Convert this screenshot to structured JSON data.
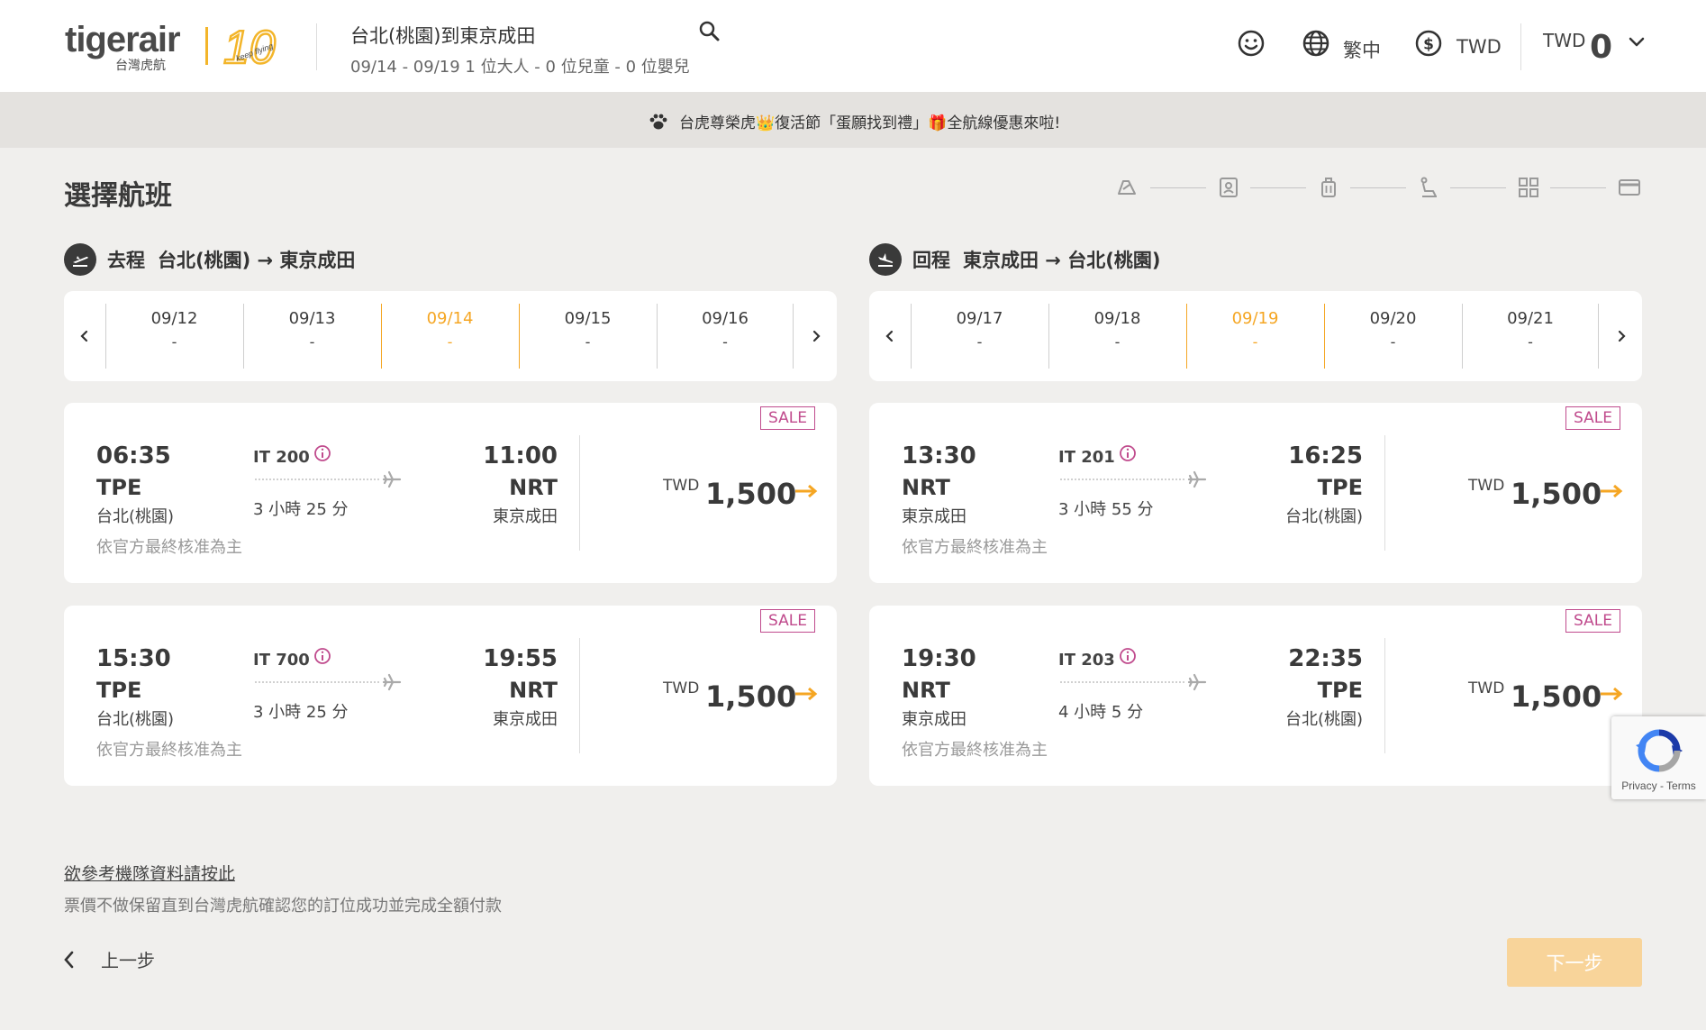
{
  "header": {
    "logo_text": "tigerair",
    "logo_sub": "台灣虎航",
    "logo_anniv": "10",
    "logo_tag": "keep flying",
    "route_title": "台北(桃園)到東京成田",
    "route_sub": "09/14 - 09/19 1 位大人 - 0 位兒童 - 0 位嬰兒",
    "language": "繁中",
    "currency": "TWD",
    "cart_currency": "TWD",
    "cart_total": "0"
  },
  "banner": {
    "text": "台虎尊榮虎👑復活節「蛋願找到禮」🎁全航線優惠來啦!"
  },
  "page": {
    "title": "選擇航班"
  },
  "steps": [
    "flight-icon",
    "passenger-icon",
    "baggage-icon",
    "seat-icon",
    "addons-icon",
    "payment-icon"
  ],
  "outbound": {
    "label": "去程",
    "route": "台北(桃園) → 東京成田",
    "dates": [
      {
        "date": "09/12",
        "price": "-"
      },
      {
        "date": "09/13",
        "price": "-"
      },
      {
        "date": "09/14",
        "price": "-"
      },
      {
        "date": "09/15",
        "price": "-"
      },
      {
        "date": "09/16",
        "price": "-"
      }
    ],
    "flights": [
      {
        "sale": "SALE",
        "dep_time": "06:35",
        "dep_code": "TPE",
        "dep_name": "台北(桃園)",
        "flight_no": "IT 200",
        "duration": "3 小時 25 分",
        "arr_time": "11:00",
        "arr_code": "NRT",
        "arr_name": "東京成田",
        "note": "依官方最終核准為主",
        "currency": "TWD",
        "price": "1,500"
      },
      {
        "sale": "SALE",
        "dep_time": "15:30",
        "dep_code": "TPE",
        "dep_name": "台北(桃園)",
        "flight_no": "IT 700",
        "duration": "3 小時 25 分",
        "arr_time": "19:55",
        "arr_code": "NRT",
        "arr_name": "東京成田",
        "note": "依官方最終核准為主",
        "currency": "TWD",
        "price": "1,500"
      }
    ]
  },
  "inbound": {
    "label": "回程",
    "route": "東京成田 → 台北(桃園)",
    "dates": [
      {
        "date": "09/17",
        "price": "-"
      },
      {
        "date": "09/18",
        "price": "-"
      },
      {
        "date": "09/19",
        "price": "-"
      },
      {
        "date": "09/20",
        "price": "-"
      },
      {
        "date": "09/21",
        "price": "-"
      }
    ],
    "flights": [
      {
        "sale": "SALE",
        "dep_time": "13:30",
        "dep_code": "NRT",
        "dep_name": "東京成田",
        "flight_no": "IT 201",
        "duration": "3 小時 55 分",
        "arr_time": "16:25",
        "arr_code": "TPE",
        "arr_name": "台北(桃園)",
        "note": "依官方最終核准為主",
        "currency": "TWD",
        "price": "1,500"
      },
      {
        "sale": "SALE",
        "dep_time": "19:30",
        "dep_code": "NRT",
        "dep_name": "東京成田",
        "flight_no": "IT 203",
        "duration": "4 小時 5 分",
        "arr_time": "22:35",
        "arr_code": "TPE",
        "arr_name": "台北(桃園)",
        "note": "依官方最終核准為主",
        "currency": "TWD",
        "price": "1,500"
      }
    ]
  },
  "footer": {
    "fleet_link": "欲參考機隊資料請按此",
    "disclaimer": "票價不做保留直到台灣虎航確認您的訂位成功並完成全額付款",
    "back_label": "上一步",
    "next_label": "下一步"
  },
  "recaptcha": {
    "text": "Privacy - Terms"
  },
  "colors": {
    "accent": "#f5a623",
    "sale": "#c04b8d",
    "next_disabled": "#f8d49a",
    "background": "#f0efed"
  }
}
